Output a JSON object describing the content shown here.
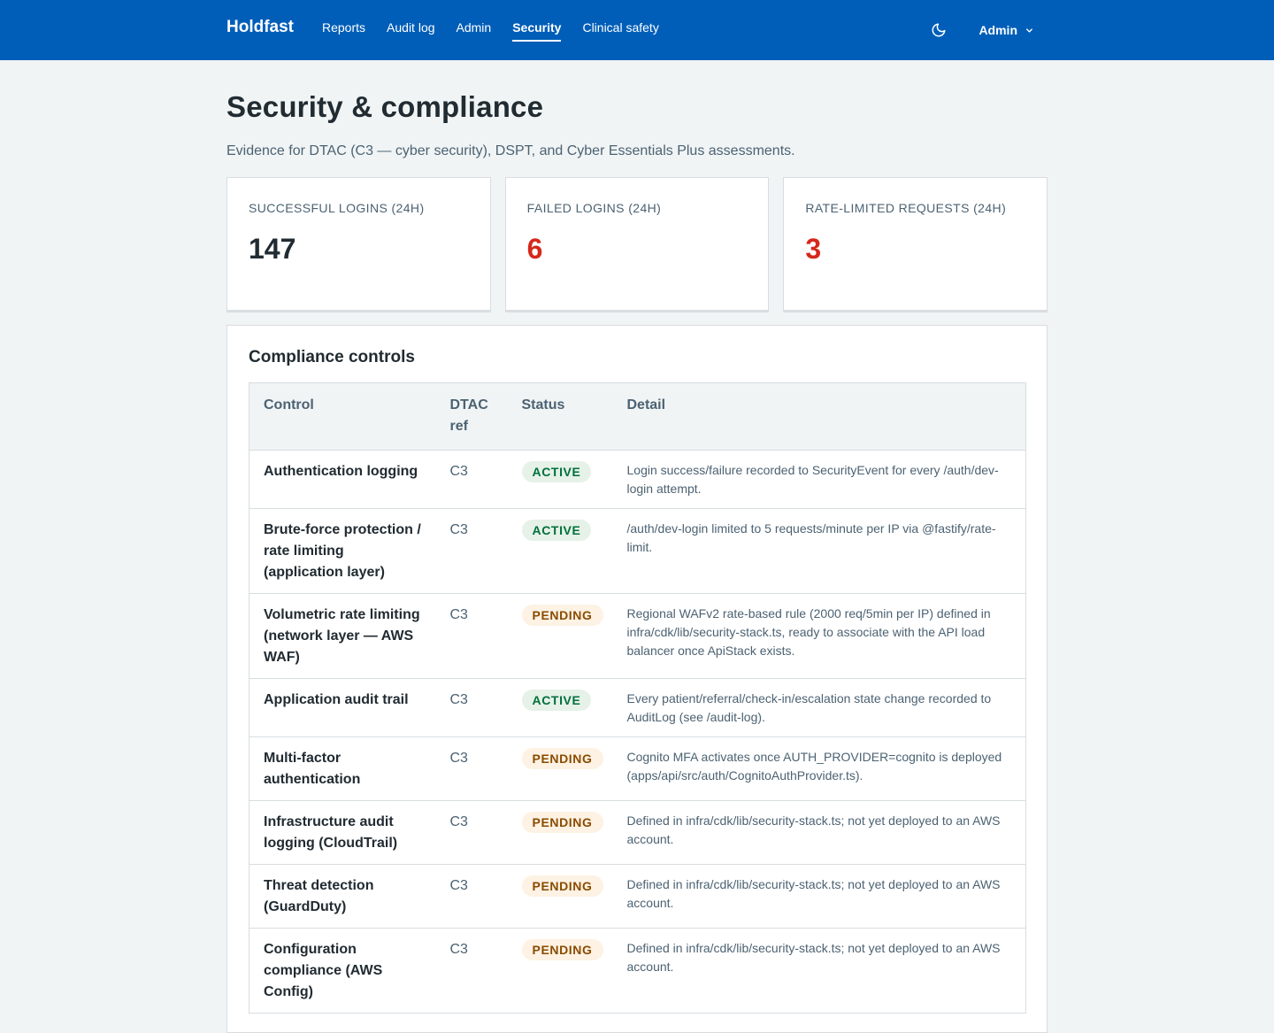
{
  "header": {
    "brand": "Holdfast",
    "nav": [
      {
        "label": "Reports",
        "active": false
      },
      {
        "label": "Audit log",
        "active": false
      },
      {
        "label": "Admin",
        "active": false
      },
      {
        "label": "Security",
        "active": true
      },
      {
        "label": "Clinical safety",
        "active": false
      }
    ],
    "theme_toggle_icon": "moon-icon",
    "user_menu_label": "Admin"
  },
  "page": {
    "title": "Security & compliance",
    "subtitle": "Evidence for DTAC (C3 — cyber security), DSPT, and Cyber Essentials Plus assessments."
  },
  "stats": [
    {
      "label": "SUCCESSFUL LOGINS (24H)",
      "value": "147",
      "alert": false
    },
    {
      "label": "FAILED LOGINS (24H)",
      "value": "6",
      "alert": true
    },
    {
      "label": "RATE-LIMITED REQUESTS (24H)",
      "value": "3",
      "alert": true
    }
  ],
  "controls": {
    "title": "Compliance controls",
    "columns": [
      "Control",
      "DTAC ref",
      "Status",
      "Detail"
    ],
    "rows": [
      {
        "control": "Authentication logging",
        "ref": "C3",
        "status": "ACTIVE",
        "detail": "Login success/failure recorded to SecurityEvent for every /auth/dev-login attempt."
      },
      {
        "control": "Brute-force protection / rate limiting (application layer)",
        "ref": "C3",
        "status": "ACTIVE",
        "detail": "/auth/dev-login limited to 5 requests/minute per IP via @fastify/rate-limit."
      },
      {
        "control": "Volumetric rate limiting (network layer — AWS WAF)",
        "ref": "C3",
        "status": "PENDING",
        "detail": "Regional WAFv2 rate-based rule (2000 req/5min per IP) defined in infra/cdk/lib/security-stack.ts, ready to associate with the API load balancer once ApiStack exists."
      },
      {
        "control": "Application audit trail",
        "ref": "C3",
        "status": "ACTIVE",
        "detail": "Every patient/referral/check-in/escalation state change recorded to AuditLog (see /audit-log)."
      },
      {
        "control": "Multi-factor authentication",
        "ref": "C3",
        "status": "PENDING",
        "detail": "Cognito MFA activates once AUTH_PROVIDER=cognito is deployed (apps/api/src/auth/CognitoAuthProvider.ts)."
      },
      {
        "control": "Infrastructure audit logging (CloudTrail)",
        "ref": "C3",
        "status": "PENDING",
        "detail": "Defined in infra/cdk/lib/security-stack.ts; not yet deployed to an AWS account."
      },
      {
        "control": "Threat detection (GuardDuty)",
        "ref": "C3",
        "status": "PENDING",
        "detail": "Defined in infra/cdk/lib/security-stack.ts; not yet deployed to an AWS account."
      },
      {
        "control": "Configuration compliance (AWS Config)",
        "ref": "C3",
        "status": "PENDING",
        "detail": "Defined in infra/cdk/lib/security-stack.ts; not yet deployed to an AWS account."
      }
    ]
  }
}
